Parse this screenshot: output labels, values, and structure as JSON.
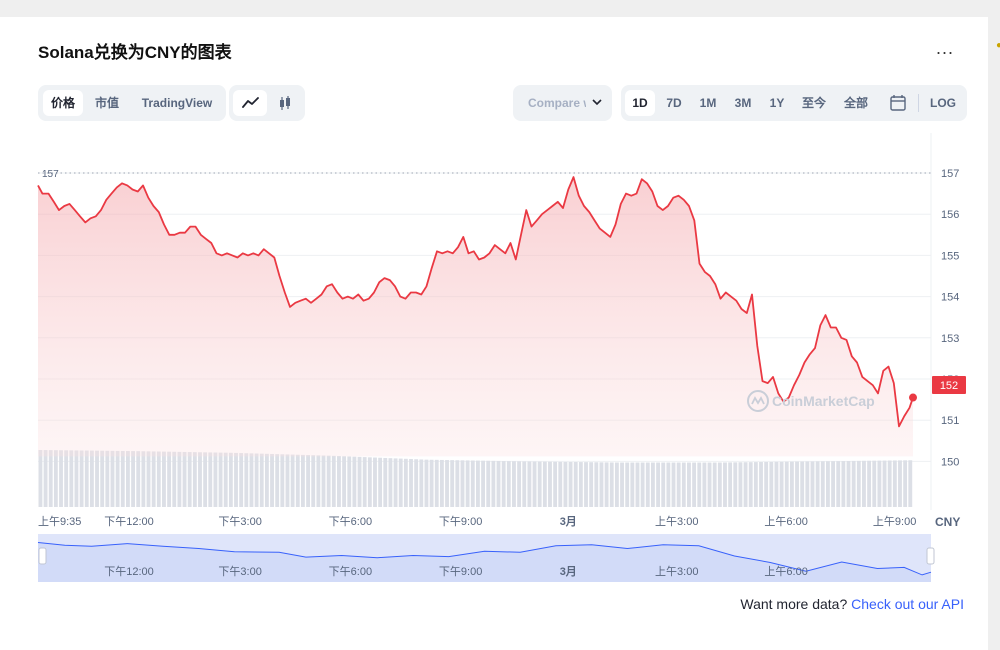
{
  "title": "Solana兑换为CNY的图表",
  "more_label": "...",
  "type_tabs": [
    "价格",
    "市值",
    "TradingView"
  ],
  "type_tabs_active": 0,
  "chart_style": [
    "line-chart-icon",
    "candlestick-icon"
  ],
  "compare_label": "Compare with",
  "range_tabs": [
    "1D",
    "7D",
    "1M",
    "3M",
    "1Y",
    "至今",
    "全部"
  ],
  "range_active": 0,
  "calendar_icon": "calendar-icon",
  "log_label": "LOG",
  "watermark": "CoinMarketCap",
  "api_prompt": "Want more data?",
  "api_link": "Check out our API",
  "colors": {
    "line": "#ea3943",
    "fill": "#f6c9cc",
    "volume": "#dcdfe6",
    "nav_fill": "#dfe5fa",
    "nav_line": "#3861fb",
    "link": "#3861fb"
  },
  "chart_data": {
    "type": "line",
    "currency": "CNY",
    "y_ticks": [
      157,
      156,
      155,
      154,
      153,
      152,
      151,
      150
    ],
    "ylim": [
      149.5,
      158
    ],
    "reference_line": 157,
    "current_value": 152,
    "x_tick_labels": [
      "上午9:35",
      "下午12:00",
      "下午3:00",
      "下午6:00",
      "下午9:00",
      "3月",
      "上午3:00",
      "上午6:00",
      "上午9:00"
    ],
    "x_tick_pos": [
      0.0,
      0.104,
      0.231,
      0.357,
      0.483,
      0.606,
      0.73,
      0.855,
      0.979
    ],
    "nav_labels": [
      "下午12:00",
      "下午3:00",
      "下午6:00",
      "下午9:00",
      "3月",
      "上午3:00",
      "上午6:00"
    ],
    "nav_label_pos": [
      0.104,
      0.231,
      0.357,
      0.483,
      0.606,
      0.73,
      0.855
    ],
    "price_series": [
      [
        0.0,
        156.7
      ],
      [
        0.005,
        156.5
      ],
      [
        0.012,
        156.5
      ],
      [
        0.018,
        156.3
      ],
      [
        0.024,
        156.1
      ],
      [
        0.03,
        156.2
      ],
      [
        0.036,
        156.25
      ],
      [
        0.042,
        156.1
      ],
      [
        0.048,
        155.95
      ],
      [
        0.054,
        155.8
      ],
      [
        0.06,
        155.9
      ],
      [
        0.066,
        155.95
      ],
      [
        0.072,
        156.1
      ],
      [
        0.078,
        156.35
      ],
      [
        0.084,
        156.5
      ],
      [
        0.09,
        156.65
      ],
      [
        0.096,
        156.75
      ],
      [
        0.102,
        156.7
      ],
      [
        0.108,
        156.6
      ],
      [
        0.114,
        156.55
      ],
      [
        0.12,
        156.7
      ],
      [
        0.126,
        156.4
      ],
      [
        0.132,
        156.2
      ],
      [
        0.138,
        156.05
      ],
      [
        0.144,
        155.75
      ],
      [
        0.15,
        155.5
      ],
      [
        0.156,
        155.5
      ],
      [
        0.162,
        155.55
      ],
      [
        0.168,
        155.55
      ],
      [
        0.174,
        155.7
      ],
      [
        0.18,
        155.7
      ],
      [
        0.186,
        155.5
      ],
      [
        0.192,
        155.4
      ],
      [
        0.198,
        155.3
      ],
      [
        0.204,
        155.05
      ],
      [
        0.21,
        155.0
      ],
      [
        0.216,
        155.05
      ],
      [
        0.222,
        155.0
      ],
      [
        0.228,
        154.95
      ],
      [
        0.234,
        155.05
      ],
      [
        0.24,
        155.0
      ],
      [
        0.246,
        155.05
      ],
      [
        0.252,
        155.0
      ],
      [
        0.258,
        155.15
      ],
      [
        0.264,
        155.05
      ],
      [
        0.27,
        154.95
      ],
      [
        0.276,
        154.5
      ],
      [
        0.282,
        154.1
      ],
      [
        0.288,
        153.75
      ],
      [
        0.294,
        153.85
      ],
      [
        0.3,
        153.9
      ],
      [
        0.306,
        153.95
      ],
      [
        0.312,
        153.85
      ],
      [
        0.318,
        153.95
      ],
      [
        0.324,
        154.05
      ],
      [
        0.33,
        154.25
      ],
      [
        0.336,
        154.3
      ],
      [
        0.342,
        154.1
      ],
      [
        0.348,
        153.95
      ],
      [
        0.354,
        154.0
      ],
      [
        0.36,
        153.95
      ],
      [
        0.366,
        154.05
      ],
      [
        0.372,
        153.9
      ],
      [
        0.378,
        153.95
      ],
      [
        0.384,
        154.1
      ],
      [
        0.39,
        154.35
      ],
      [
        0.396,
        154.45
      ],
      [
        0.402,
        154.4
      ],
      [
        0.408,
        154.25
      ],
      [
        0.414,
        154.0
      ],
      [
        0.42,
        153.95
      ],
      [
        0.426,
        154.1
      ],
      [
        0.432,
        154.1
      ],
      [
        0.438,
        154.05
      ],
      [
        0.444,
        154.25
      ],
      [
        0.45,
        154.7
      ],
      [
        0.456,
        155.1
      ],
      [
        0.462,
        155.05
      ],
      [
        0.468,
        155.1
      ],
      [
        0.474,
        155.05
      ],
      [
        0.48,
        155.2
      ],
      [
        0.486,
        155.45
      ],
      [
        0.492,
        155.05
      ],
      [
        0.498,
        155.1
      ],
      [
        0.504,
        154.9
      ],
      [
        0.51,
        154.95
      ],
      [
        0.516,
        155.05
      ],
      [
        0.522,
        155.25
      ],
      [
        0.528,
        155.15
      ],
      [
        0.534,
        155.05
      ],
      [
        0.54,
        155.3
      ],
      [
        0.546,
        154.9
      ],
      [
        0.552,
        155.5
      ],
      [
        0.558,
        156.1
      ],
      [
        0.564,
        155.7
      ],
      [
        0.57,
        155.85
      ],
      [
        0.576,
        156.0
      ],
      [
        0.582,
        156.1
      ],
      [
        0.588,
        156.2
      ],
      [
        0.594,
        156.3
      ],
      [
        0.6,
        156.15
      ],
      [
        0.606,
        156.6
      ],
      [
        0.612,
        156.9
      ],
      [
        0.618,
        156.45
      ],
      [
        0.624,
        156.2
      ],
      [
        0.63,
        156.05
      ],
      [
        0.636,
        155.85
      ],
      [
        0.642,
        155.65
      ],
      [
        0.648,
        155.55
      ],
      [
        0.654,
        155.45
      ],
      [
        0.66,
        155.75
      ],
      [
        0.666,
        156.25
      ],
      [
        0.672,
        156.5
      ],
      [
        0.678,
        156.45
      ],
      [
        0.684,
        156.5
      ],
      [
        0.69,
        156.85
      ],
      [
        0.696,
        156.75
      ],
      [
        0.702,
        156.55
      ],
      [
        0.708,
        156.2
      ],
      [
        0.714,
        156.1
      ],
      [
        0.72,
        156.2
      ],
      [
        0.726,
        156.4
      ],
      [
        0.732,
        156.45
      ],
      [
        0.738,
        156.35
      ],
      [
        0.744,
        156.2
      ],
      [
        0.75,
        155.85
      ],
      [
        0.756,
        154.8
      ],
      [
        0.762,
        154.6
      ],
      [
        0.768,
        154.5
      ],
      [
        0.774,
        154.3
      ],
      [
        0.78,
        153.95
      ],
      [
        0.786,
        154.1
      ],
      [
        0.792,
        154.0
      ],
      [
        0.798,
        153.9
      ],
      [
        0.804,
        153.7
      ],
      [
        0.81,
        153.6
      ],
      [
        0.816,
        154.05
      ],
      [
        0.822,
        152.8
      ],
      [
        0.828,
        151.95
      ],
      [
        0.834,
        151.9
      ],
      [
        0.84,
        152.05
      ],
      [
        0.846,
        151.65
      ],
      [
        0.852,
        151.45
      ],
      [
        0.858,
        151.55
      ],
      [
        0.864,
        151.85
      ],
      [
        0.87,
        152.1
      ],
      [
        0.876,
        152.4
      ],
      [
        0.882,
        152.6
      ],
      [
        0.888,
        152.75
      ],
      [
        0.894,
        153.3
      ],
      [
        0.9,
        153.55
      ],
      [
        0.906,
        153.25
      ],
      [
        0.912,
        153.25
      ],
      [
        0.918,
        153.0
      ],
      [
        0.924,
        152.95
      ],
      [
        0.93,
        152.55
      ],
      [
        0.936,
        152.4
      ],
      [
        0.942,
        152.05
      ],
      [
        0.948,
        151.95
      ],
      [
        0.954,
        151.85
      ],
      [
        0.96,
        151.65
      ],
      [
        0.966,
        152.2
      ],
      [
        0.972,
        152.3
      ],
      [
        0.978,
        151.9
      ],
      [
        0.984,
        150.85
      ],
      [
        0.99,
        151.1
      ],
      [
        0.996,
        151.3
      ],
      [
        1.0,
        151.55
      ]
    ],
    "nav_series": [
      [
        0.0,
        156.9
      ],
      [
        0.03,
        156.4
      ],
      [
        0.06,
        156.2
      ],
      [
        0.1,
        156.7
      ],
      [
        0.14,
        156.2
      ],
      [
        0.18,
        155.8
      ],
      [
        0.22,
        155.2
      ],
      [
        0.27,
        155.1
      ],
      [
        0.3,
        154.2
      ],
      [
        0.34,
        154.5
      ],
      [
        0.38,
        154.1
      ],
      [
        0.42,
        154.5
      ],
      [
        0.46,
        154.3
      ],
      [
        0.5,
        155.3
      ],
      [
        0.54,
        155.1
      ],
      [
        0.58,
        156.3
      ],
      [
        0.62,
        156.5
      ],
      [
        0.66,
        155.8
      ],
      [
        0.7,
        156.5
      ],
      [
        0.74,
        156.3
      ],
      [
        0.78,
        154.4
      ],
      [
        0.82,
        153.2
      ],
      [
        0.86,
        151.6
      ],
      [
        0.9,
        153.3
      ],
      [
        0.94,
        152.1
      ],
      [
        0.97,
        152.3
      ],
      [
        0.99,
        150.9
      ],
      [
        1.0,
        151.4
      ]
    ],
    "volume_levels": [
      1.0,
      0.98,
      0.95,
      0.9,
      0.83,
      0.8,
      0.78,
      0.78,
      0.8,
      0.82
    ]
  }
}
